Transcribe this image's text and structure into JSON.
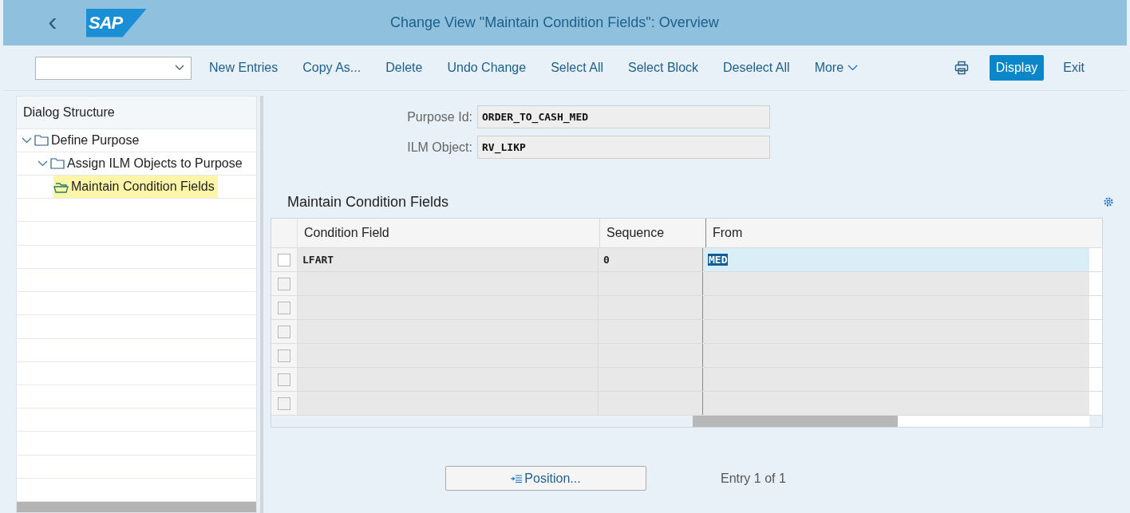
{
  "header": {
    "title": "Change View \"Maintain Condition Fields\": Overview",
    "logo": "SAP",
    "back": "‹"
  },
  "toolbar": {
    "actions": [
      {
        "label": "New Entries",
        "kind": "text"
      },
      {
        "label": "Copy As...",
        "kind": "text"
      },
      {
        "label": "Delete",
        "kind": "text"
      },
      {
        "label": "Undo Change",
        "kind": "text"
      },
      {
        "label": "Select All",
        "kind": "text"
      },
      {
        "label": "Select Block",
        "kind": "text"
      },
      {
        "label": "Deselect All",
        "kind": "text"
      },
      {
        "label": "More",
        "kind": "menu"
      }
    ],
    "right": [
      {
        "kind": "print"
      },
      {
        "label": "Display",
        "kind": "primary"
      },
      {
        "label": "Exit",
        "kind": "text"
      }
    ]
  },
  "dialog_structure": {
    "title": "Dialog Structure",
    "items": [
      {
        "label": "Define Purpose",
        "expanded": true,
        "selected": false,
        "children": [
          {
            "label": "Assign ILM Objects to Purpose",
            "expanded": true,
            "selected": false,
            "children": [
              {
                "label": "Maintain Condition Fields",
                "expanded": false,
                "selected": true
              }
            ]
          }
        ]
      }
    ]
  },
  "fields": [
    {
      "label": "Purpose Id:",
      "value": "ORDER_TO_CASH_MED"
    },
    {
      "label": "ILM Object:",
      "value": "RV_LIKP"
    }
  ],
  "table": {
    "title": "Maintain Condition Fields",
    "columns": [
      "Condition Field",
      "Sequence",
      "From"
    ],
    "rows": [
      {
        "cells": [
          "LFART",
          "0",
          "MED"
        ],
        "selected": false,
        "focused": true
      },
      {
        "selected": false
      },
      {
        "selected": false
      },
      {
        "selected": false
      },
      {
        "selected": false
      },
      {
        "selected": false
      },
      {
        "selected": false
      }
    ]
  },
  "footer": {
    "position_button": "Position...",
    "entry": "Entry 1 of 1"
  }
}
